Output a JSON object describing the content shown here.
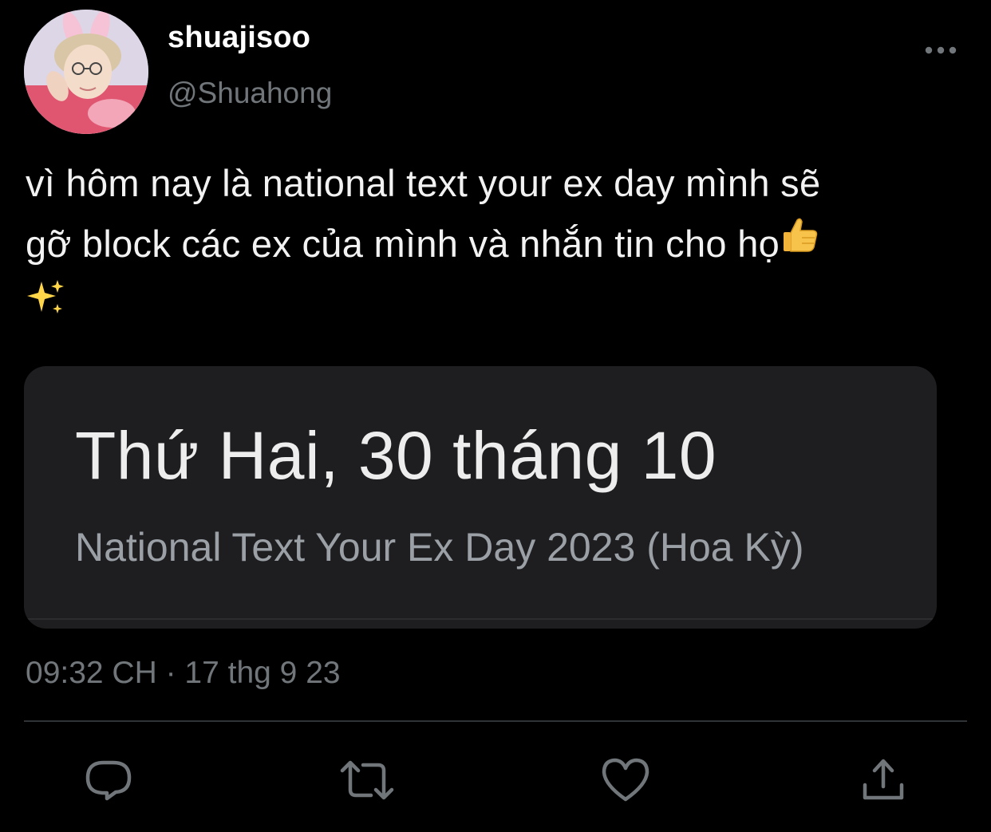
{
  "tweet": {
    "author": {
      "display_name": "shuajisoo",
      "handle": "@Shuahong"
    },
    "text": {
      "line1": "vì hôm nay là national text your ex day mình sẽ",
      "line2": "gỡ block các ex của mình và nhắn tin cho họ",
      "emoji_thumbs": "👍",
      "emoji_sparkles": "✨"
    },
    "media_card": {
      "date": "Thứ Hai, 30 tháng 10",
      "event": "National Text Your Ex Day 2023 (Hoa Kỳ)"
    },
    "timestamp": "09:32 CH · 17 thg 9 23"
  },
  "actions": [
    {
      "name": "reply",
      "icon": "reply-icon"
    },
    {
      "name": "retweet",
      "icon": "retweet-icon"
    },
    {
      "name": "like",
      "icon": "heart-icon"
    },
    {
      "name": "share",
      "icon": "share-icon"
    }
  ],
  "colors": {
    "background": "#000000",
    "primary_text": "#e7e9ea",
    "secondary_text": "#71767b",
    "card_background": "#1e1e20",
    "icon": "#71767b"
  }
}
